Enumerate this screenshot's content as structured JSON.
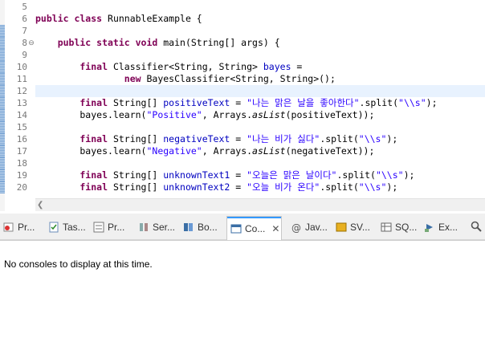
{
  "editor": {
    "lines": [
      {
        "no": "5",
        "fold": "",
        "segs": [
          {
            "t": "",
            "c": ""
          }
        ]
      },
      {
        "no": "6",
        "fold": "",
        "segs": [
          {
            "t": "public class ",
            "c": "kw"
          },
          {
            "t": "RunnableExample {",
            "c": ""
          }
        ]
      },
      {
        "no": "7",
        "fold": "",
        "segs": [
          {
            "t": "",
            "c": ""
          }
        ]
      },
      {
        "no": "8",
        "fold": "⊖",
        "segs": [
          {
            "t": "    public static void ",
            "c": "kw"
          },
          {
            "t": "main(String[] args) {",
            "c": ""
          }
        ]
      },
      {
        "no": "9",
        "fold": "",
        "segs": [
          {
            "t": "",
            "c": ""
          }
        ]
      },
      {
        "no": "10",
        "fold": "",
        "segs": [
          {
            "t": "        final ",
            "c": "kw"
          },
          {
            "t": "Classifier<String, String> ",
            "c": ""
          },
          {
            "t": "bayes",
            "c": "var"
          },
          {
            "t": " =",
            "c": ""
          }
        ]
      },
      {
        "no": "11",
        "fold": "",
        "segs": [
          {
            "t": "                new ",
            "c": "kw"
          },
          {
            "t": "BayesClassifier<String, String>();",
            "c": ""
          }
        ]
      },
      {
        "no": "12",
        "fold": "",
        "segs": [
          {
            "t": "",
            "c": ""
          }
        ]
      },
      {
        "no": "13",
        "fold": "",
        "segs": [
          {
            "t": "        final ",
            "c": "kw"
          },
          {
            "t": "String[] ",
            "c": ""
          },
          {
            "t": "positiveText",
            "c": "var"
          },
          {
            "t": " = ",
            "c": ""
          },
          {
            "t": "\"나는 맑은 날을 좋아한다\"",
            "c": "str"
          },
          {
            "t": ".split(",
            "c": ""
          },
          {
            "t": "\"\\\\s\"",
            "c": "str"
          },
          {
            "t": ");",
            "c": ""
          }
        ]
      },
      {
        "no": "14",
        "fold": "",
        "segs": [
          {
            "t": "        bayes.learn(",
            "c": ""
          },
          {
            "t": "\"Positive\"",
            "c": "str"
          },
          {
            "t": ", Arrays.",
            "c": ""
          },
          {
            "t": "asList",
            "c": "it"
          },
          {
            "t": "(positiveText));",
            "c": ""
          }
        ]
      },
      {
        "no": "15",
        "fold": "",
        "segs": [
          {
            "t": "",
            "c": ""
          }
        ]
      },
      {
        "no": "16",
        "fold": "",
        "segs": [
          {
            "t": "        final ",
            "c": "kw"
          },
          {
            "t": "String[] ",
            "c": ""
          },
          {
            "t": "negativeText",
            "c": "var"
          },
          {
            "t": " = ",
            "c": ""
          },
          {
            "t": "\"나는 비가 싫다\"",
            "c": "str"
          },
          {
            "t": ".split(",
            "c": ""
          },
          {
            "t": "\"\\\\s\"",
            "c": "str"
          },
          {
            "t": ");",
            "c": ""
          }
        ]
      },
      {
        "no": "17",
        "fold": "",
        "segs": [
          {
            "t": "        bayes.learn(",
            "c": ""
          },
          {
            "t": "\"Negative\"",
            "c": "str"
          },
          {
            "t": ", Arrays.",
            "c": ""
          },
          {
            "t": "asList",
            "c": "it"
          },
          {
            "t": "(negativeText));",
            "c": ""
          }
        ]
      },
      {
        "no": "18",
        "fold": "",
        "segs": [
          {
            "t": "",
            "c": ""
          }
        ]
      },
      {
        "no": "19",
        "fold": "",
        "segs": [
          {
            "t": "        final ",
            "c": "kw"
          },
          {
            "t": "String[] ",
            "c": ""
          },
          {
            "t": "unknownText1",
            "c": "var"
          },
          {
            "t": " = ",
            "c": ""
          },
          {
            "t": "\"오늘은 맑은 날이다\"",
            "c": "str"
          },
          {
            "t": ".split(",
            "c": ""
          },
          {
            "t": "\"\\\\s\"",
            "c": "str"
          },
          {
            "t": ");",
            "c": ""
          }
        ]
      },
      {
        "no": "20",
        "fold": "",
        "segs": [
          {
            "t": "        final ",
            "c": "kw"
          },
          {
            "t": "String[] ",
            "c": ""
          },
          {
            "t": "unknownText2",
            "c": "var"
          },
          {
            "t": " = ",
            "c": ""
          },
          {
            "t": "\"오늘 비가 온다\"",
            "c": "str"
          },
          {
            "t": ".split(",
            "c": ""
          },
          {
            "t": "\"\\\\s\"",
            "c": "str"
          },
          {
            "t": ");",
            "c": ""
          }
        ]
      }
    ],
    "current_line": "12"
  },
  "tabs": [
    {
      "label": "Pr...",
      "icon": "problems-icon",
      "active": false
    },
    {
      "label": "Tas...",
      "icon": "tasks-icon",
      "active": false
    },
    {
      "label": "Pr...",
      "icon": "properties-icon",
      "active": false
    },
    {
      "label": "Ser...",
      "icon": "servers-icon",
      "active": false
    },
    {
      "label": "Bo...",
      "icon": "bookmarks-icon",
      "active": false
    },
    {
      "label": "Co...",
      "icon": "console-icon",
      "active": true
    },
    {
      "label": "Jav...",
      "icon": "javadoc-icon",
      "active": false
    },
    {
      "label": "SV...",
      "icon": "svn-icon",
      "active": false
    },
    {
      "label": "SQ...",
      "icon": "sql-icon",
      "active": false
    },
    {
      "label": "Ex...",
      "icon": "explorer-icon",
      "active": false
    }
  ],
  "console": {
    "message": "No consoles to display at this time."
  },
  "colors": {
    "keyword": "#7f0055",
    "string": "#2a00ff",
    "field": "#0000c0",
    "current_line": "#e8f2fe",
    "active_tab_accent": "#3399ff"
  }
}
